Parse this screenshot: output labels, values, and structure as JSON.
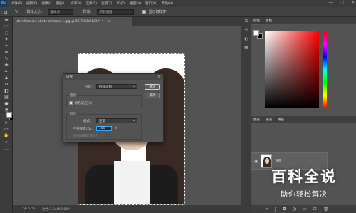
{
  "menubar": {
    "logo": "Ps",
    "items": [
      "文件(F)",
      "编辑(E)",
      "图像(I)",
      "图层(L)",
      "文字(Y)",
      "选择(S)",
      "滤镜(T)",
      "3D(D)",
      "视图(V)",
      "窗口(W)",
      "帮助(H)"
    ],
    "window_controls": [
      "—",
      "□",
      "✕"
    ]
  },
  "options": {
    "size_label": "取样大小：",
    "size_value": "取样点",
    "sample_label": "样本：",
    "sample_value": "所有图层",
    "show_ring": "显示取样环"
  },
  "document": {
    "tab_title": "identification-photo-delicate-1.jpg @ 66.7%(RGB/8#) *",
    "tab_close": "×"
  },
  "status": {
    "zoom": "66.67%",
    "info": "文档:3.84M/3.84M"
  },
  "fill_dialog": {
    "title": "填充",
    "content_label": "内容：",
    "content_value": "内容识别",
    "options_group": "选项",
    "color_adapt": "颜色适应(C)",
    "blend_group": "混合",
    "mode_label": "模式：",
    "mode_value": "正常",
    "opacity_label": "不透明度(O)：",
    "opacity_value": "100",
    "opacity_unit": "%",
    "preserve": "保留透明区域(P)",
    "ok": "确定",
    "cancel": "取消"
  },
  "panels": {
    "color_tabs": [
      "颜色",
      "色板"
    ],
    "layers_tabs": [
      "图层",
      "通道",
      "路径"
    ],
    "layer_name": "背景"
  },
  "watermark": {
    "title": "百科全说",
    "subtitle": "助你轻松解决"
  },
  "colors": {
    "accent": "#31a8ff",
    "app_bg": "#535353",
    "panel_dark": "#3c3c3c"
  }
}
